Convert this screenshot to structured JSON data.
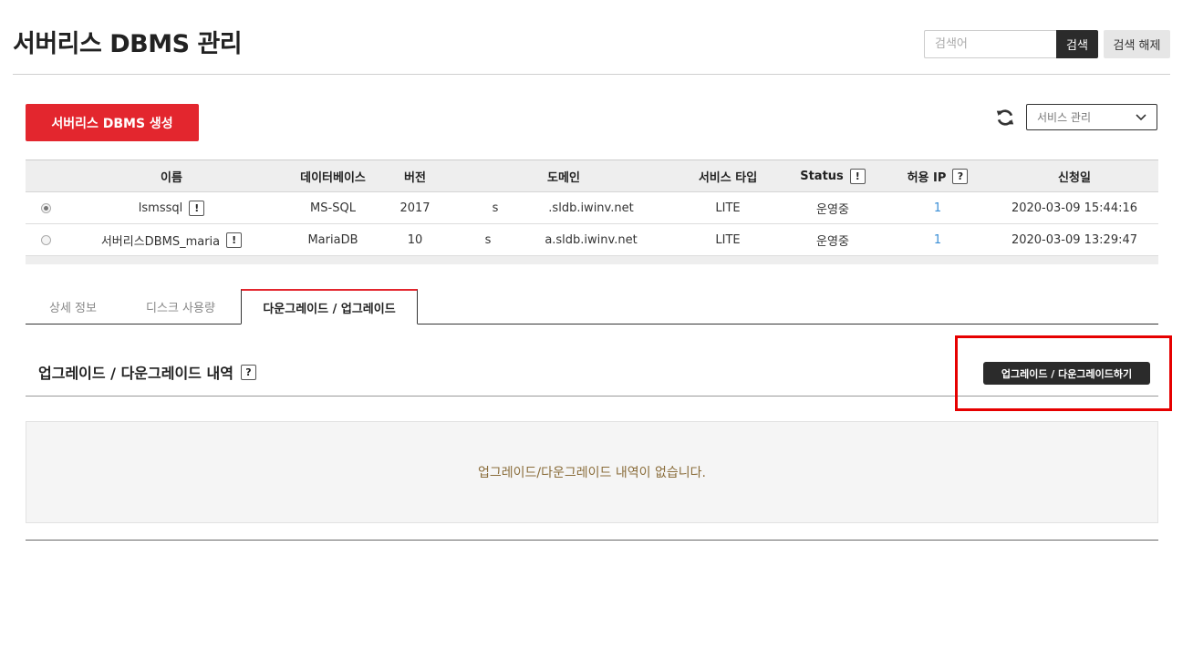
{
  "header": {
    "title": "서버리스 DBMS 관리",
    "search_placeholder": "검색어",
    "search_label": "검색",
    "search_reset_label": "검색 해제"
  },
  "toolbar": {
    "create_label": "서버리스 DBMS 생성",
    "service_select_value": "서비스 관리"
  },
  "table": {
    "headers": {
      "name": "이름",
      "database": "데이터베이스",
      "version": "버전",
      "domain": "도메인",
      "service_type": "서비스 타입",
      "status": "Status",
      "allowed_ip": "허용 IP",
      "request_date": "신청일"
    },
    "header_icons": {
      "status": "!",
      "allowed_ip": "?"
    },
    "rows": [
      {
        "selected": true,
        "name": "lsmssql",
        "name_icon": "!",
        "database": "MS-SQL",
        "version": "2017",
        "domain_prefix": "s",
        "domain": ".sldb.iwinv.net",
        "service_type": "LITE",
        "status": "운영중",
        "allowed_ip": "1",
        "request_date": "2020-03-09 15:44:16"
      },
      {
        "selected": false,
        "name": "서버리스DBMS_maria",
        "name_icon": "!",
        "database": "MariaDB",
        "version": "10",
        "domain_prefix": "s",
        "domain": "a.sldb.iwinv.net",
        "service_type": "LITE",
        "status": "운영중",
        "allowed_ip": "1",
        "request_date": "2020-03-09 13:29:47"
      }
    ]
  },
  "tabs": [
    {
      "label": "상세 정보",
      "active": false
    },
    {
      "label": "디스크 사용량",
      "active": false
    },
    {
      "label": "다운그레이드 / 업그레이드",
      "active": true
    }
  ],
  "section": {
    "title": "업그레이드 / 다운그레이드 내역",
    "title_icon": "?",
    "action_label": "업그레이드 / 다운그레이드하기",
    "empty_message": "업그레이드/다운그레이드 내역이 없습니다."
  },
  "colors": {
    "accent_red": "#e3262e",
    "dark_button": "#2b2b2b",
    "link_blue": "#3b8fd6",
    "highlight_red": "#e60000",
    "empty_text": "#8a6d3b"
  }
}
